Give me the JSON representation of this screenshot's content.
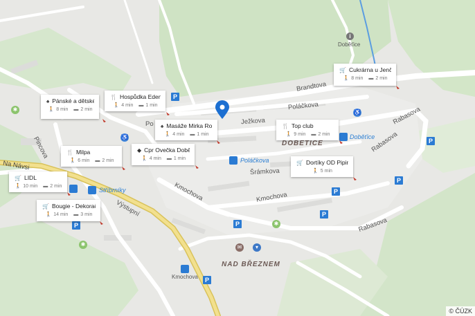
{
  "colors": {
    "accent": "#2b7bd3",
    "marker": "#1c6fd1",
    "road_main": "#e3cd5b"
  },
  "streets": {
    "brandtova": "Brandtova",
    "polackova": "Poláčkova",
    "jezkova": "Ježkova",
    "sramkova": "Šrámkova",
    "kmochova1": "Kmochova",
    "kmochova2": "Kmochova",
    "kmochova3": "Kmochova",
    "rabasova1": "Rabasova",
    "rabasova2": "Rabasova",
    "rabasova3": "Rabasova",
    "vystupni": "Výstupní",
    "pincova": "Pincova",
    "na_navsi": "Na Návsi",
    "po": "Po"
  },
  "areas": {
    "dobetice_area": "DOBĚTICE",
    "nad_breznem": "NAD BŘEZNEM",
    "dobetice_small": "Doběťice"
  },
  "stops": {
    "dobetice": "Doběťice",
    "polackova": "Poláčkova",
    "stribrniky": "Stříbrníky",
    "kmochova": "Kmochova"
  },
  "pois": [
    {
      "name": "Pánské a dětské ...",
      "icon": "tree-icon",
      "walk": "8 min",
      "car": "2 min"
    },
    {
      "name": "Hospůdka Eden",
      "icon": "restaurant-icon",
      "walk": "4 min",
      "car": "1 min"
    },
    {
      "name": "Masáže Mirka Ro...",
      "icon": "tree-icon",
      "walk": "4 min",
      "car": "1 min"
    },
    {
      "name": "Cukrárna u Jenču",
      "icon": "cart-icon",
      "walk": "8 min",
      "car": "2 min"
    },
    {
      "name": "Top club",
      "icon": "restaurant-icon",
      "walk": "9 min",
      "car": "2 min"
    },
    {
      "name": "Milpa",
      "icon": "restaurant-icon",
      "walk": "6 min",
      "car": "2 min"
    },
    {
      "name": "Cpr Ovečka Době...",
      "icon": "school-icon",
      "walk": "4 min",
      "car": "1 min"
    },
    {
      "name": "LIDL",
      "icon": "cart-icon",
      "walk": "10 min",
      "car": "2 min"
    },
    {
      "name": "Bougie - Dekorač...",
      "icon": "cart-icon",
      "walk": "14 min",
      "car": "3 min"
    },
    {
      "name": "Dortíky OD Pipinky",
      "icon": "cart-icon",
      "walk": "5 min",
      "car": ""
    }
  ],
  "parking_label": "P",
  "copyright": "© ČÚZK"
}
